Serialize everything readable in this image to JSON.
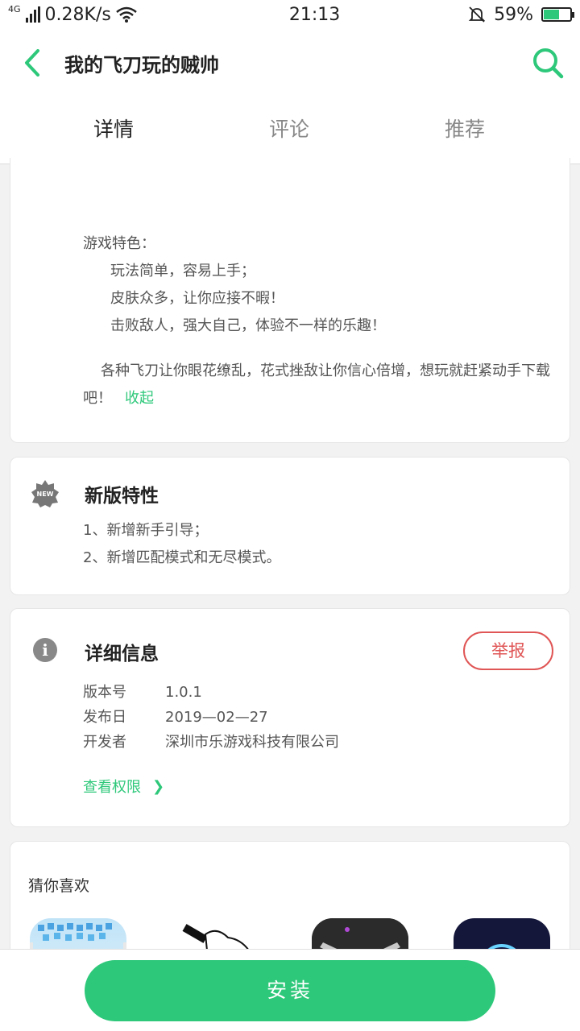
{
  "status_bar": {
    "network_type": "4G",
    "speed": "0.28K/s",
    "time": "21:13",
    "battery": "59%",
    "battery_level": 0.59
  },
  "header": {
    "title": "我的飞刀玩的贼帅"
  },
  "tabs": [
    {
      "label": "详情",
      "active": true
    },
    {
      "label": "评论",
      "active": false
    },
    {
      "label": "推荐",
      "active": false
    }
  ],
  "description": {
    "heading": "游戏特色：",
    "features": [
      "玩法简单，容易上手；",
      "皮肤众多，让你应接不暇！",
      "击败敌人，强大自己，体验不一样的乐趣！"
    ],
    "paragraph": "各种飞刀让你眼花缭乱，花式挫敌让你信心倍增，想玩就赶紧动手下载吧！",
    "collapse_label": "收起"
  },
  "new_features": {
    "badge": "NEW",
    "title": "新版特性",
    "items": [
      "1、新增新手引导；",
      "2、新增匹配模式和无尽模式。"
    ]
  },
  "details": {
    "title": "详细信息",
    "report_label": "举报",
    "rows": [
      {
        "key": "版本号",
        "value": "1.0.1"
      },
      {
        "key": "发布日",
        "value": "2019—02—27"
      },
      {
        "key": "开发者",
        "value": "深圳市乐游戏科技有限公司"
      }
    ],
    "permissions_label": "查看权限",
    "permissions_arrow": "❯"
  },
  "recommend": {
    "title": "猜你喜欢"
  },
  "install": {
    "label": "安装"
  },
  "colors": {
    "accent": "#2ec87a",
    "report": "#e05555"
  }
}
